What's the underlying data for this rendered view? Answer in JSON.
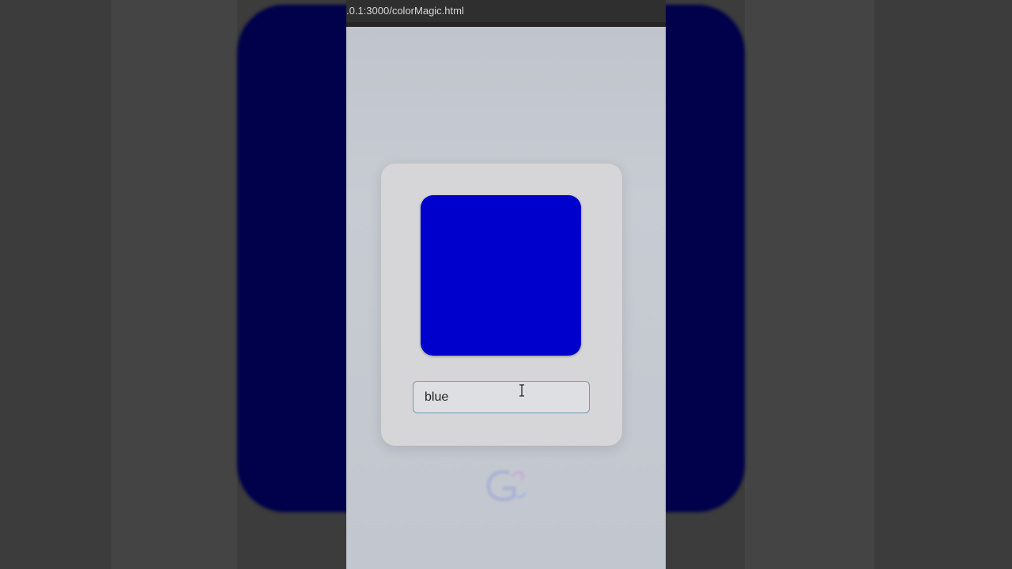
{
  "browser": {
    "url": ".0.1:3000/colorMagic.html"
  },
  "color_magic": {
    "input_value": "blue",
    "swatch_color": "#0000cd",
    "background_swatch_color": "#00004b"
  },
  "icons": {
    "cursor": "text-cursor-icon",
    "watermark": "channel-logo-icon"
  }
}
